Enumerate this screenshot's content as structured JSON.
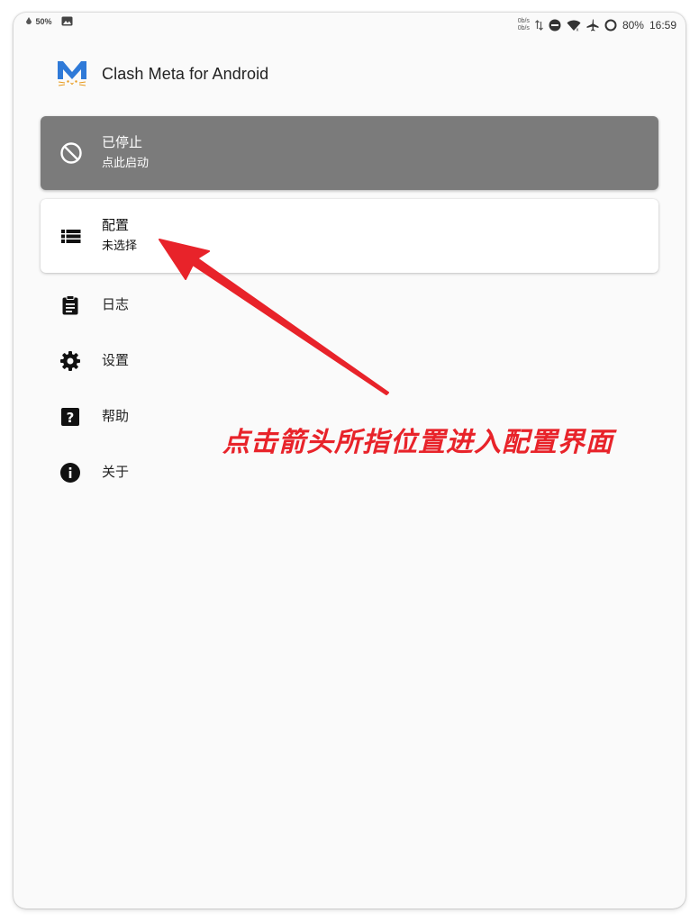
{
  "status_bar": {
    "battery_saver": "50%",
    "net_speed_up": "0b/s",
    "net_speed_down": "0b/s",
    "battery": "80%",
    "time": "16:59"
  },
  "header": {
    "title": "Clash Meta for Android"
  },
  "status_card": {
    "title": "已停止",
    "subtitle": "点此启动"
  },
  "profile_card": {
    "title": "配置",
    "subtitle": "未选择"
  },
  "menu": {
    "logs": "日志",
    "settings": "设置",
    "help": "帮助",
    "about": "关于"
  },
  "annotation": {
    "text": "点击箭头所指位置进入配置界面",
    "color": "#e8232a"
  },
  "colors": {
    "status_card_bg": "#7b7b7b",
    "page_bg": "#fafafa"
  }
}
